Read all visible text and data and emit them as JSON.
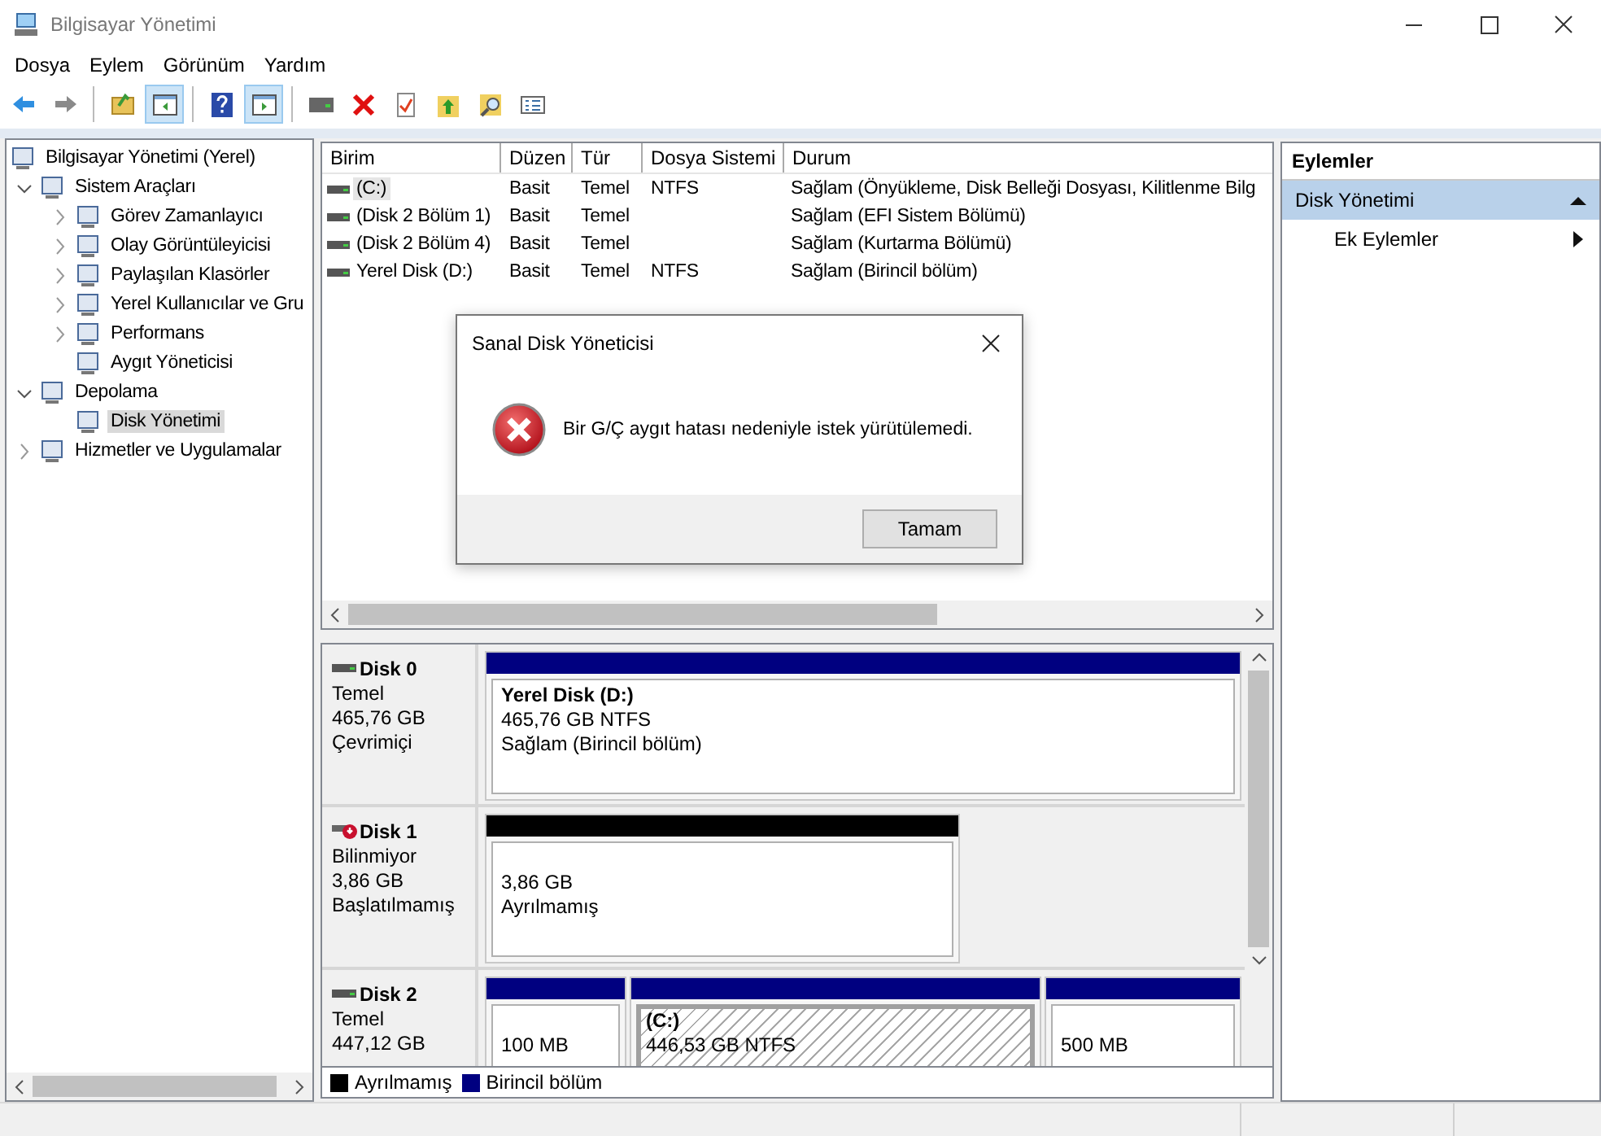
{
  "window": {
    "title": "Bilgisayar Yönetimi"
  },
  "menu": [
    "Dosya",
    "Eylem",
    "Görünüm",
    "Yardım"
  ],
  "toolbar": [
    [
      {
        "pressed": false
      },
      {
        "pressed": false
      }
    ],
    [
      {
        "pressed": false
      },
      {
        "pressed": true
      }
    ],
    [
      {
        "pressed": false
      },
      {
        "pressed": true
      }
    ],
    [
      {
        "pressed": false
      },
      {
        "pressed": false
      },
      {
        "pressed": false
      },
      {
        "pressed": false
      },
      {
        "pressed": false
      },
      {
        "pressed": false
      }
    ]
  ],
  "tree": [
    {
      "label": "Bilgisayar Yönetimi (Yerel)",
      "selected": false,
      "children": [
        {
          "label": "Sistem Araçları",
          "expanded": true,
          "selected": false,
          "children": [
            {
              "label": "Görev Zamanlayıcı",
              "expanded": false,
              "selected": false
            },
            {
              "label": "Olay Görüntüleyicisi",
              "expanded": false,
              "selected": false
            },
            {
              "label": "Paylaşılan Klasörler",
              "expanded": false,
              "selected": false
            },
            {
              "label": "Yerel Kullanıcılar ve Gru",
              "expanded": false,
              "selected": false
            },
            {
              "label": "Performans",
              "expanded": false,
              "selected": false
            },
            {
              "label": "Aygıt Yöneticisi",
              "selected": false
            }
          ]
        },
        {
          "label": "Depolama",
          "expanded": true,
          "selected": false,
          "children": [
            {
              "label": "Disk Yönetimi",
              "selected": true
            }
          ]
        },
        {
          "label": "Hizmetler ve Uygulamalar",
          "expanded": false,
          "selected": false
        }
      ]
    }
  ],
  "volumes": {
    "columns": [
      "Birim",
      "Düzen",
      "Tür",
      "Dosya Sistemi",
      "Durum"
    ],
    "rows": [
      {
        "selected": true,
        "cells": [
          "(C:)",
          "Basit",
          "Temel",
          "NTFS",
          "Sağlam (Önyükleme, Disk Belleği Dosyası, Kilitlenme Bilg"
        ]
      },
      {
        "selected": false,
        "cells": [
          "(Disk 2 Bölüm 1)",
          "Basit",
          "Temel",
          "",
          "Sağlam (EFI Sistem Bölümü)"
        ]
      },
      {
        "selected": false,
        "cells": [
          "(Disk 2 Bölüm 4)",
          "Basit",
          "Temel",
          "",
          "Sağlam (Kurtarma Bölümü)"
        ]
      },
      {
        "selected": false,
        "cells": [
          "Yerel Disk (D:)",
          "Basit",
          "Temel",
          "NTFS",
          "Sağlam (Birincil bölüm)"
        ]
      }
    ]
  },
  "disks": [
    {
      "name": "Disk 0",
      "error": false,
      "lines": [
        "Temel",
        "465,76 GB",
        "Çevrimiçi"
      ],
      "partitions": [
        {
          "kind": "primary",
          "selected": false,
          "title": "Yerel Disk  (D:)",
          "lines": [
            "465,76 GB NTFS",
            "Sağlam (Birincil bölüm)"
          ]
        }
      ]
    },
    {
      "name": "Disk 1",
      "error": true,
      "lines": [
        "Bilinmiyor",
        "3,86 GB",
        "Başlatılmamış"
      ],
      "partitions": [
        {
          "kind": "unallocated",
          "selected": false,
          "lines": [
            "3,86 GB",
            "Ayrılmamış"
          ]
        }
      ]
    },
    {
      "name": "Disk 2",
      "error": false,
      "lines": [
        "Temel",
        "447,12 GB"
      ],
      "partitions": [
        {
          "kind": "primary",
          "selected": false,
          "lines": [
            "100 MB"
          ]
        },
        {
          "kind": "primary",
          "selected": true,
          "title": "(C:)",
          "lines": [
            "446,53 GB NTFS"
          ]
        },
        {
          "kind": "primary",
          "selected": false,
          "lines": [
            "500 MB"
          ]
        }
      ]
    }
  ],
  "legend": [
    {
      "kind": "unallocated",
      "label": "Ayrılmamış"
    },
    {
      "kind": "primary",
      "label": "Birincil bölüm"
    }
  ],
  "actions": {
    "title": "Eylemler",
    "sections": [
      {
        "label": "Disk Yönetimi",
        "expanded": true,
        "items": [
          "Ek Eylemler"
        ]
      }
    ]
  },
  "dialog": {
    "title": "Sanal Disk Yöneticisi",
    "message": "Bir G/Ç aygıt hatası nedeniyle istek yürütülemedi.",
    "button": "Tamam"
  }
}
